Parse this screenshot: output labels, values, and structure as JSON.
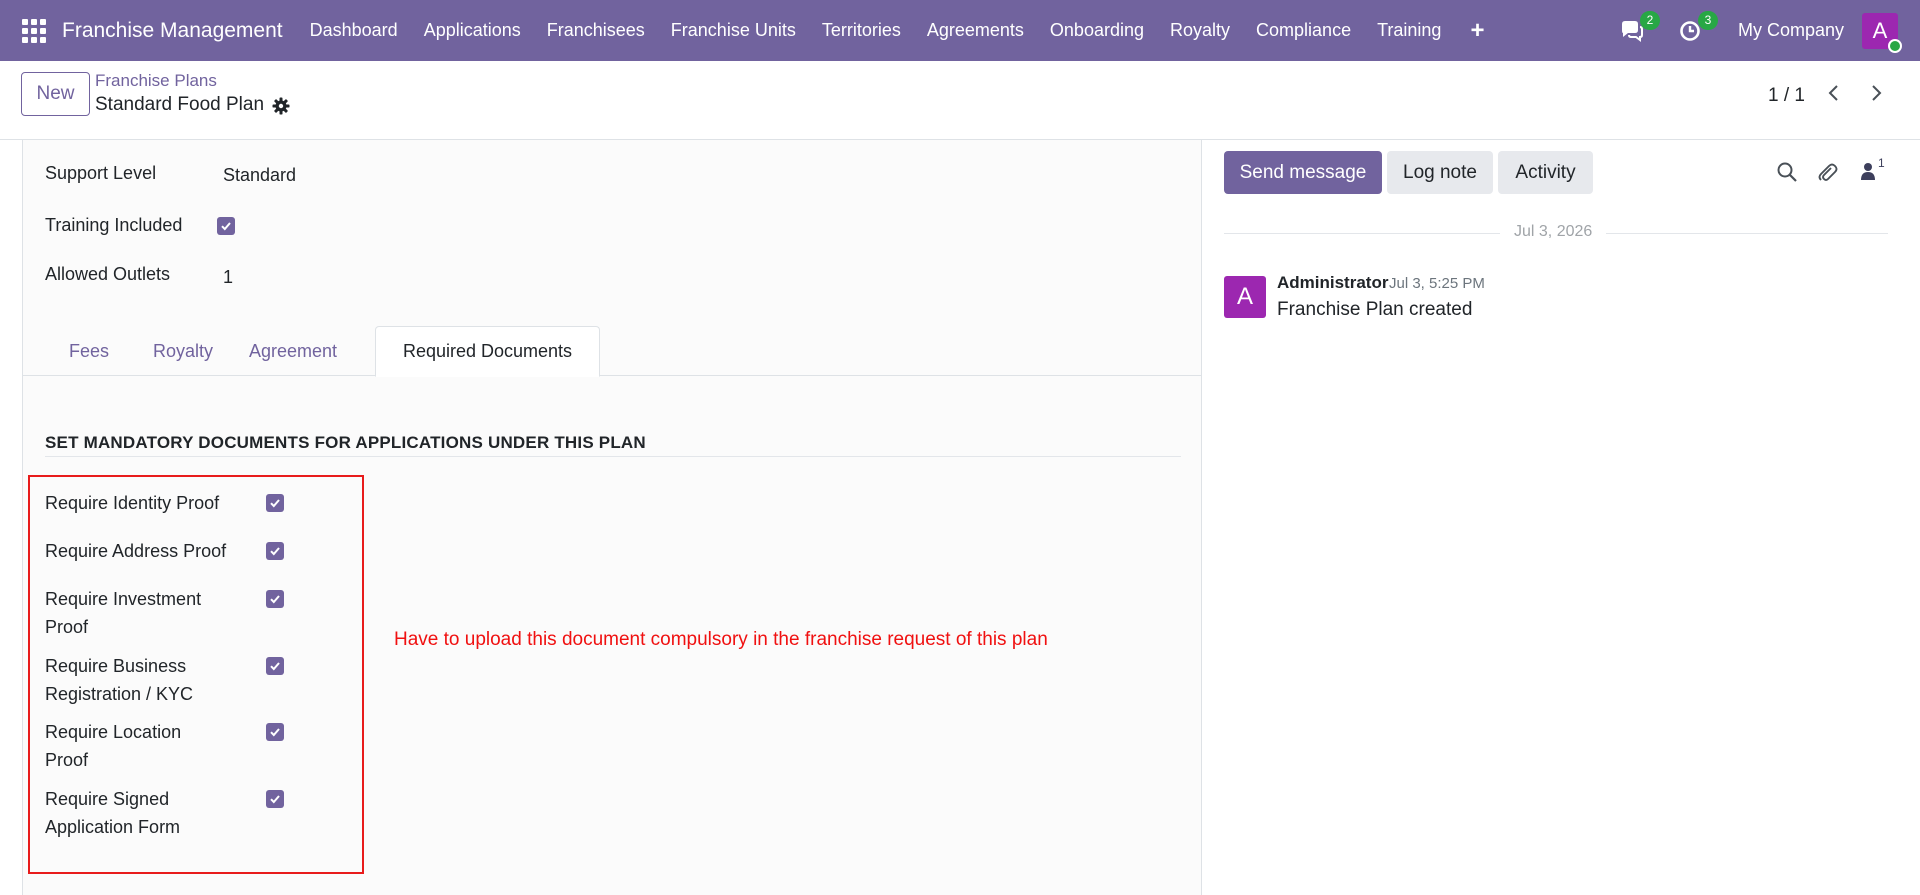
{
  "navbar": {
    "app_title": "Franchise Management",
    "menu": [
      "Dashboard",
      "Applications",
      "Franchisees",
      "Franchise Units",
      "Territories",
      "Agreements",
      "Onboarding",
      "Royalty",
      "Compliance",
      "Training"
    ],
    "messages_count": "2",
    "activities_count": "3",
    "company": "My Company",
    "user_initial": "A"
  },
  "control": {
    "new_label": "New",
    "breadcrumb_parent": "Franchise Plans",
    "record_name": "Standard Food Plan",
    "pager": "1 / 1"
  },
  "form": {
    "fields": {
      "support_level_label": "Support Level",
      "support_level_value": "Standard",
      "training_label": "Training Included",
      "training_checked": true,
      "outlets_label": "Allowed Outlets",
      "outlets_value": "1"
    },
    "tabs": [
      "Fees",
      "Royalty",
      "Agreement",
      "Required Documents"
    ],
    "active_tab": "Required Documents",
    "section_title": "SET MANDATORY DOCUMENTS FOR APPLICATIONS UNDER THIS PLAN",
    "documents": [
      {
        "line1": "Require Identity Proof",
        "line2": "",
        "checked": true
      },
      {
        "line1": "Require Address Proof",
        "line2": "",
        "checked": true
      },
      {
        "line1": "Require Investment",
        "line2": "Proof",
        "checked": true
      },
      {
        "line1": "Require Business",
        "line2": "Registration / KYC",
        "checked": true
      },
      {
        "line1": "Require Location",
        "line2": "Proof",
        "checked": true
      },
      {
        "line1": "Require Signed",
        "line2": "Application Form",
        "checked": true
      }
    ],
    "annotation": "Have to upload this document compulsory in the franchise request of this plan"
  },
  "chatter": {
    "send_message": "Send message",
    "log_note": "Log note",
    "activity": "Activity",
    "followers_count": "1",
    "date_separator": "Jul 3, 2026",
    "message": {
      "author_initial": "A",
      "author": "Administrator",
      "time": "Jul 3, 5:25 PM",
      "body": "Franchise Plan created"
    }
  },
  "colors": {
    "brand": "#71639e",
    "annotation_red": "#f01010",
    "badge_green": "#28a745",
    "avatar_purple": "#9c27b0"
  }
}
